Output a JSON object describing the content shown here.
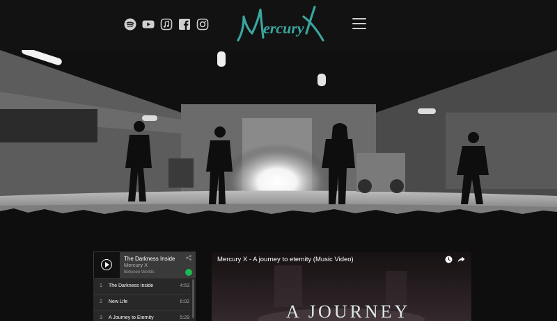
{
  "header": {
    "social_icons": [
      "spotify-icon",
      "youtube-icon",
      "apple-music-icon",
      "facebook-icon",
      "instagram-icon"
    ],
    "logo_text": "MercuryX",
    "menu_icon": "hamburger-icon"
  },
  "colors": {
    "header_bg": "#121212",
    "logo_teal": "#3aa6a0",
    "page_bg": "#0c0c0c",
    "spotify_green": "#1db954"
  },
  "spotify": {
    "title": "The Darkness Inside",
    "artist": "Mercury X",
    "album": "Between Worlds",
    "tracks": [
      {
        "num": "1",
        "name": "The Darkness Inside",
        "duration": "4:53"
      },
      {
        "num": "2",
        "name": "New Life",
        "duration": "6:02"
      },
      {
        "num": "3",
        "name": "A Journey to Eternity",
        "duration": "5:29"
      }
    ]
  },
  "video": {
    "title": "Mercury X - A journey to eternity (Music Video)",
    "overlay_text": "A JOURNEY"
  }
}
